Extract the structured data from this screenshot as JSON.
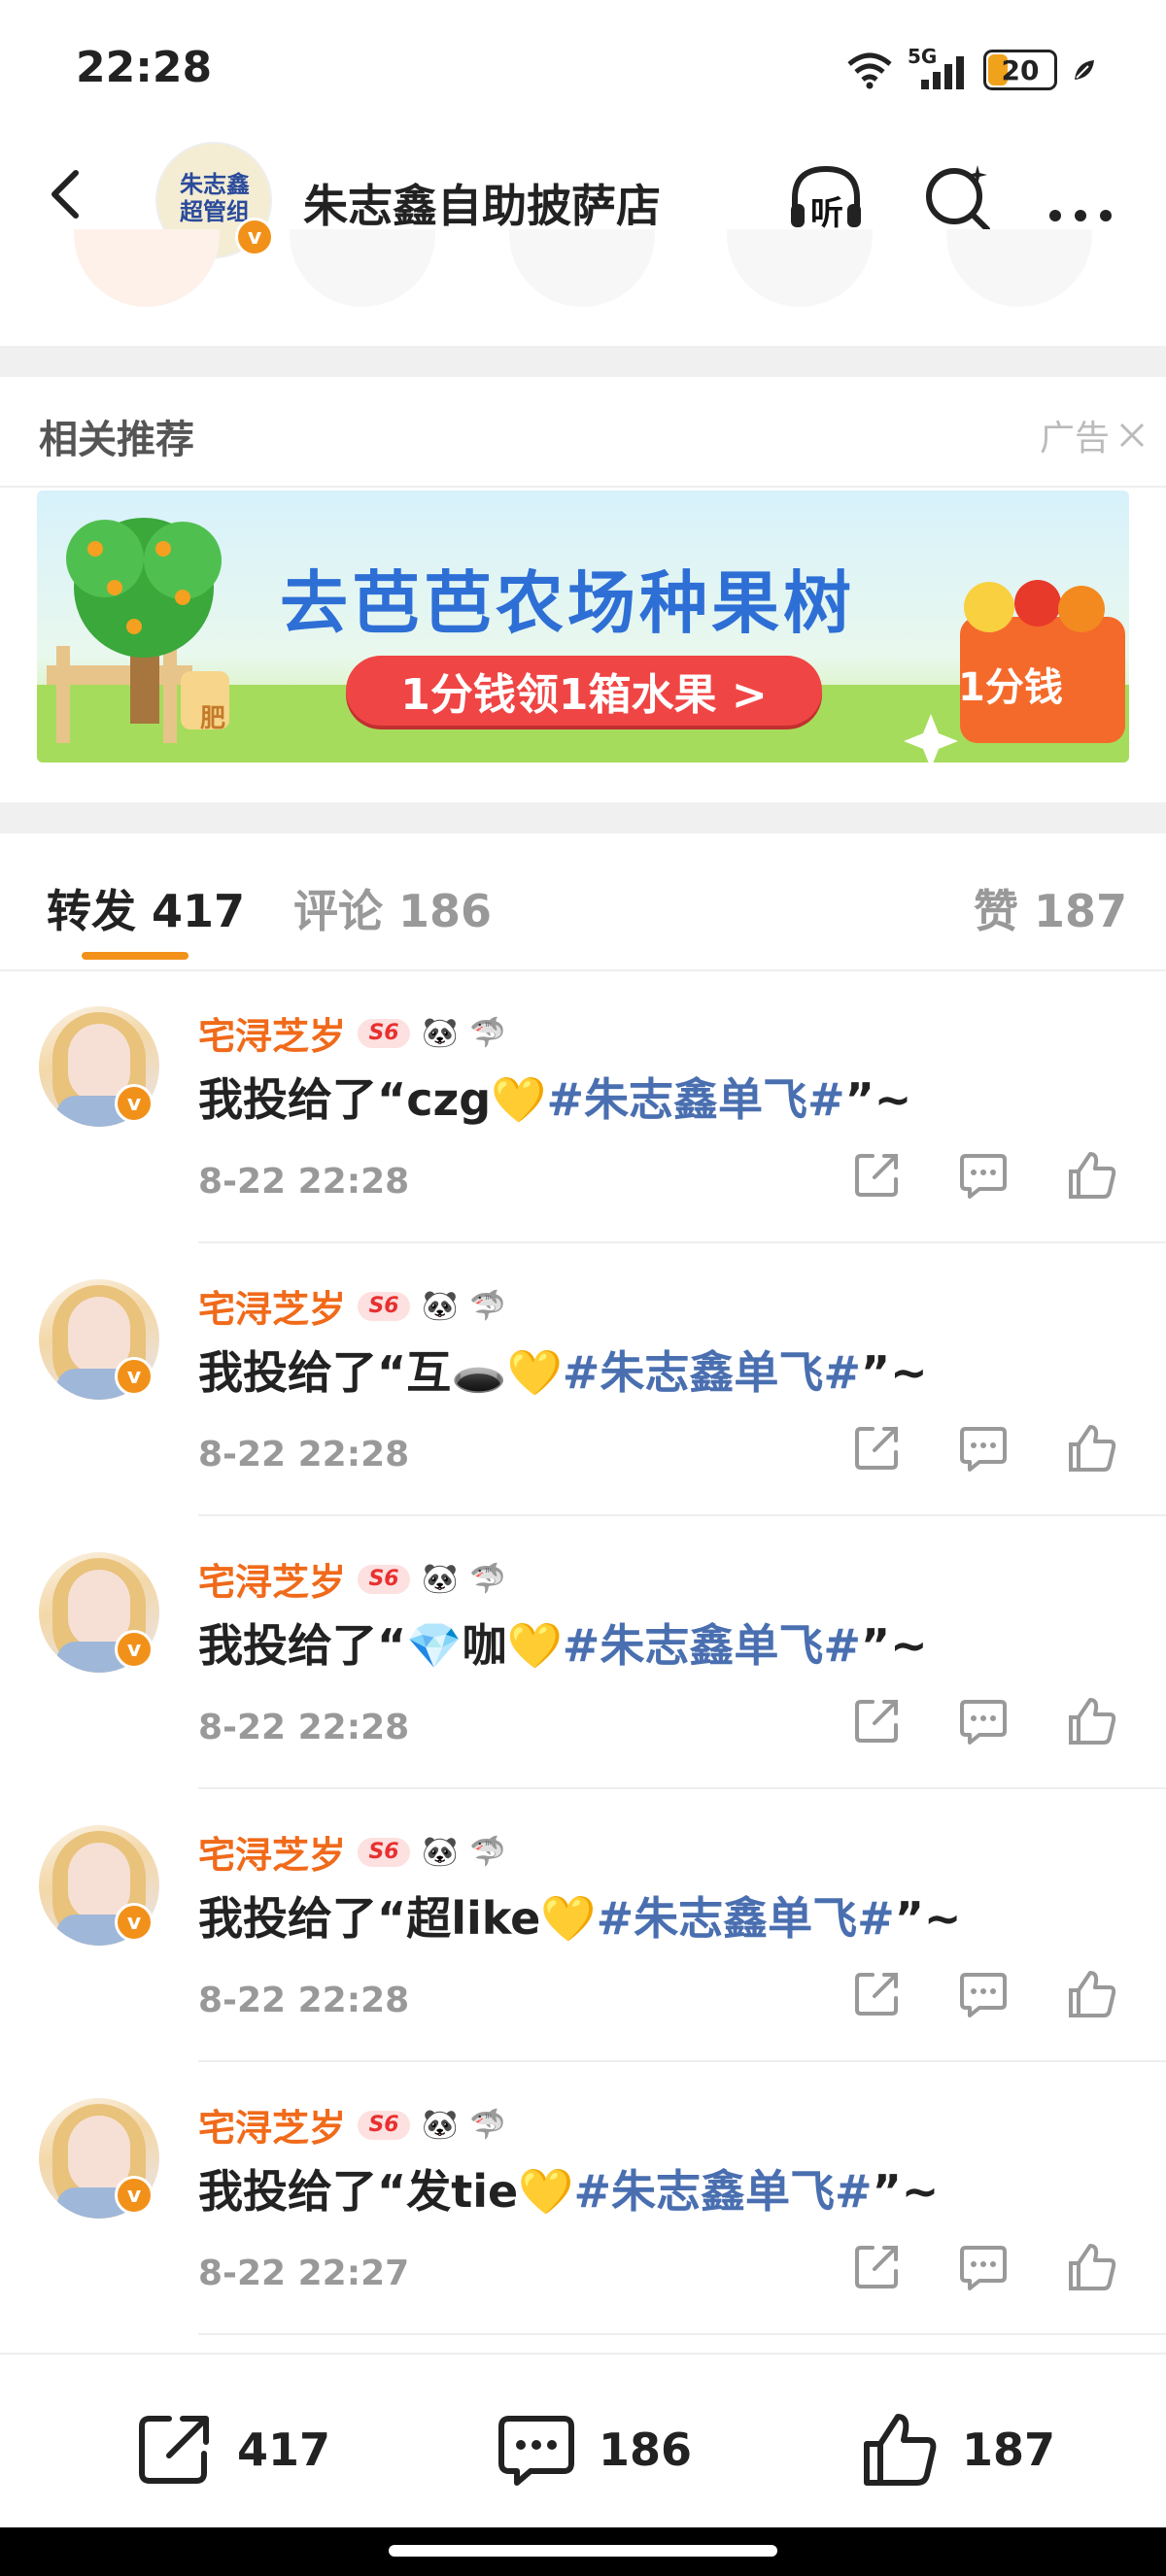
{
  "status_bar": {
    "time": "22:28",
    "network": "5G",
    "battery": "20"
  },
  "header": {
    "title": "朱志鑫自助披萨店",
    "avatar_text": "朱志鑫超管组",
    "listen_label": "听"
  },
  "recommend": {
    "title": "相关推荐",
    "ad_label": "广告",
    "banner_title": "去芭芭农场种果树",
    "banner_cta": "1分钱领1箱水果 >",
    "banner_badge": "1分钱",
    "banner_bag": "肥"
  },
  "tabs": {
    "repost": "转发 417",
    "comment": "评论 186",
    "like": "赞 187"
  },
  "reposts": [
    {
      "user": "宅浔芝岁",
      "prefix": "我投给了“czg💛",
      "tag": "#朱志鑫单飞#",
      "suffix": "”~",
      "time": "8-22 22:28"
    },
    {
      "user": "宅浔芝岁",
      "prefix": "我投给了“互🕳️💛",
      "tag": "#朱志鑫单飞#",
      "suffix": "”~",
      "time": "8-22 22:28"
    },
    {
      "user": "宅浔芝岁",
      "prefix": "我投给了“💎咖💛",
      "tag": "#朱志鑫单飞#",
      "suffix": "”~",
      "time": "8-22 22:28"
    },
    {
      "user": "宅浔芝岁",
      "prefix": "我投给了“超like💛",
      "tag": "#朱志鑫单飞#",
      "suffix": "”~",
      "time": "8-22 22:28"
    },
    {
      "user": "宅浔芝岁",
      "prefix": "我投给了“发tie💛",
      "tag": "#朱志鑫单飞#",
      "suffix": "”~",
      "time": "8-22 22:27"
    }
  ],
  "user_badges": {
    "s6": "S6",
    "emoji1": "🐼",
    "emoji2": "🦈"
  },
  "bottom_bar": {
    "repost_count": "417",
    "comment_count": "186",
    "like_count": "187"
  }
}
